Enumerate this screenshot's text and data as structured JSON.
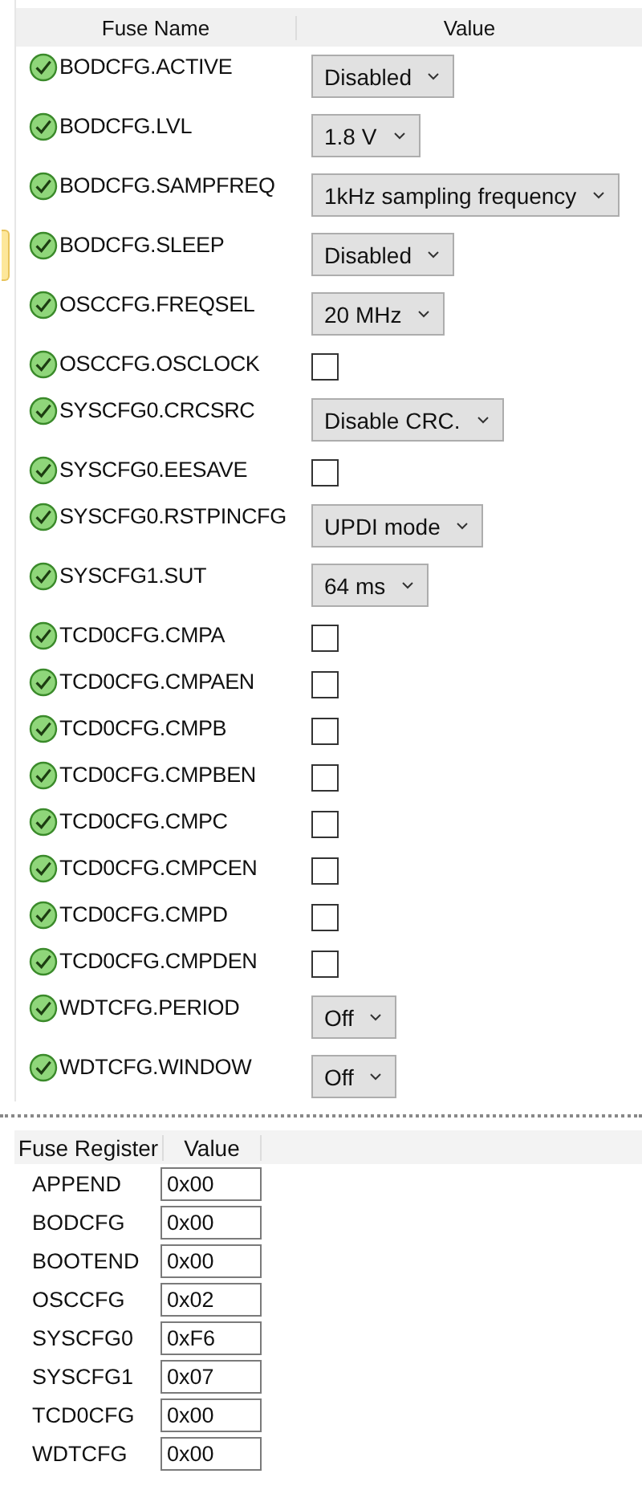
{
  "fuse_table": {
    "columns": [
      "Fuse Name",
      "Value"
    ],
    "rows": [
      {
        "name": "BODCFG.ACTIVE",
        "kind": "dropdown",
        "value": "Disabled",
        "valid": true,
        "selected": false
      },
      {
        "name": "BODCFG.LVL",
        "kind": "dropdown",
        "value": "1.8 V",
        "valid": true,
        "selected": false
      },
      {
        "name": "BODCFG.SAMPFREQ",
        "kind": "dropdown",
        "value": "1kHz sampling frequency",
        "valid": true,
        "selected": false
      },
      {
        "name": "BODCFG.SLEEP",
        "kind": "dropdown",
        "value": "Disabled",
        "valid": true,
        "selected": true
      },
      {
        "name": "OSCCFG.FREQSEL",
        "kind": "dropdown",
        "value": "20 MHz",
        "valid": true,
        "selected": false
      },
      {
        "name": "OSCCFG.OSCLOCK",
        "kind": "checkbox",
        "checked": false,
        "valid": true,
        "selected": false
      },
      {
        "name": "SYSCFG0.CRCSRC",
        "kind": "dropdown",
        "value": "Disable CRC.",
        "valid": true,
        "selected": false
      },
      {
        "name": "SYSCFG0.EESAVE",
        "kind": "checkbox",
        "checked": false,
        "valid": true,
        "selected": false
      },
      {
        "name": "SYSCFG0.RSTPINCFG",
        "kind": "dropdown",
        "value": "UPDI mode",
        "valid": true,
        "selected": false
      },
      {
        "name": "SYSCFG1.SUT",
        "kind": "dropdown",
        "value": "64 ms",
        "valid": true,
        "selected": false
      },
      {
        "name": "TCD0CFG.CMPA",
        "kind": "checkbox",
        "checked": false,
        "valid": true,
        "selected": false
      },
      {
        "name": "TCD0CFG.CMPAEN",
        "kind": "checkbox",
        "checked": false,
        "valid": true,
        "selected": false
      },
      {
        "name": "TCD0CFG.CMPB",
        "kind": "checkbox",
        "checked": false,
        "valid": true,
        "selected": false
      },
      {
        "name": "TCD0CFG.CMPBEN",
        "kind": "checkbox",
        "checked": false,
        "valid": true,
        "selected": false
      },
      {
        "name": "TCD0CFG.CMPC",
        "kind": "checkbox",
        "checked": false,
        "valid": true,
        "selected": false
      },
      {
        "name": "TCD0CFG.CMPCEN",
        "kind": "checkbox",
        "checked": false,
        "valid": true,
        "selected": false
      },
      {
        "name": "TCD0CFG.CMPD",
        "kind": "checkbox",
        "checked": false,
        "valid": true,
        "selected": false
      },
      {
        "name": "TCD0CFG.CMPDEN",
        "kind": "checkbox",
        "checked": false,
        "valid": true,
        "selected": false
      },
      {
        "name": "WDTCFG.PERIOD",
        "kind": "dropdown",
        "value": "Off",
        "valid": true,
        "selected": false
      },
      {
        "name": "WDTCFG.WINDOW",
        "kind": "dropdown",
        "value": "Off",
        "valid": true,
        "selected": false
      }
    ]
  },
  "register_table": {
    "columns": [
      "Fuse Register",
      "Value"
    ],
    "rows": [
      {
        "name": "APPEND",
        "value": "0x00"
      },
      {
        "name": "BODCFG",
        "value": "0x00"
      },
      {
        "name": "BOOTEND",
        "value": "0x00"
      },
      {
        "name": "OSCCFG",
        "value": "0x02"
      },
      {
        "name": "SYSCFG0",
        "value": "0xF6"
      },
      {
        "name": "SYSCFG1",
        "value": "0x07"
      },
      {
        "name": "TCD0CFG",
        "value": "0x00"
      },
      {
        "name": "WDTCFG",
        "value": "0x00"
      }
    ]
  }
}
